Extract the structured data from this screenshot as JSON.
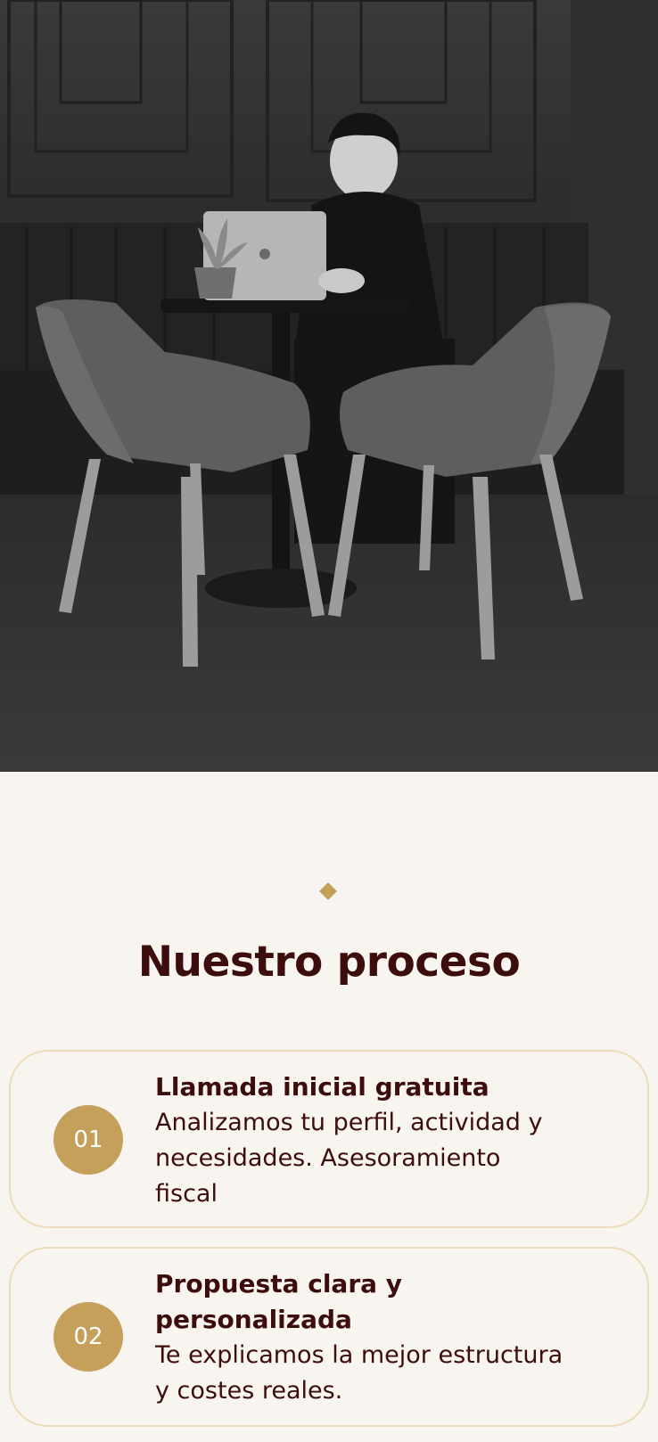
{
  "hero": {
    "image_alt": "Hombre trabajando con un portátil en una mesa con dos sillas, en blanco y negro"
  },
  "process": {
    "title": "Nuestro proceso",
    "accent_color": "#c4a05a",
    "steps": [
      {
        "number": "01",
        "title": "Llamada inicial gratuita",
        "description_lines": [
          "Analizamos tu perfil, actividad y",
          "necesidades. Asesoramiento",
          "fiscal"
        ]
      },
      {
        "number": "02",
        "title_lines": [
          "Propuesta clara y",
          "personalizada"
        ],
        "description_lines": [
          "Te explicamos la mejor estructura",
          "y costes reales."
        ]
      }
    ]
  }
}
